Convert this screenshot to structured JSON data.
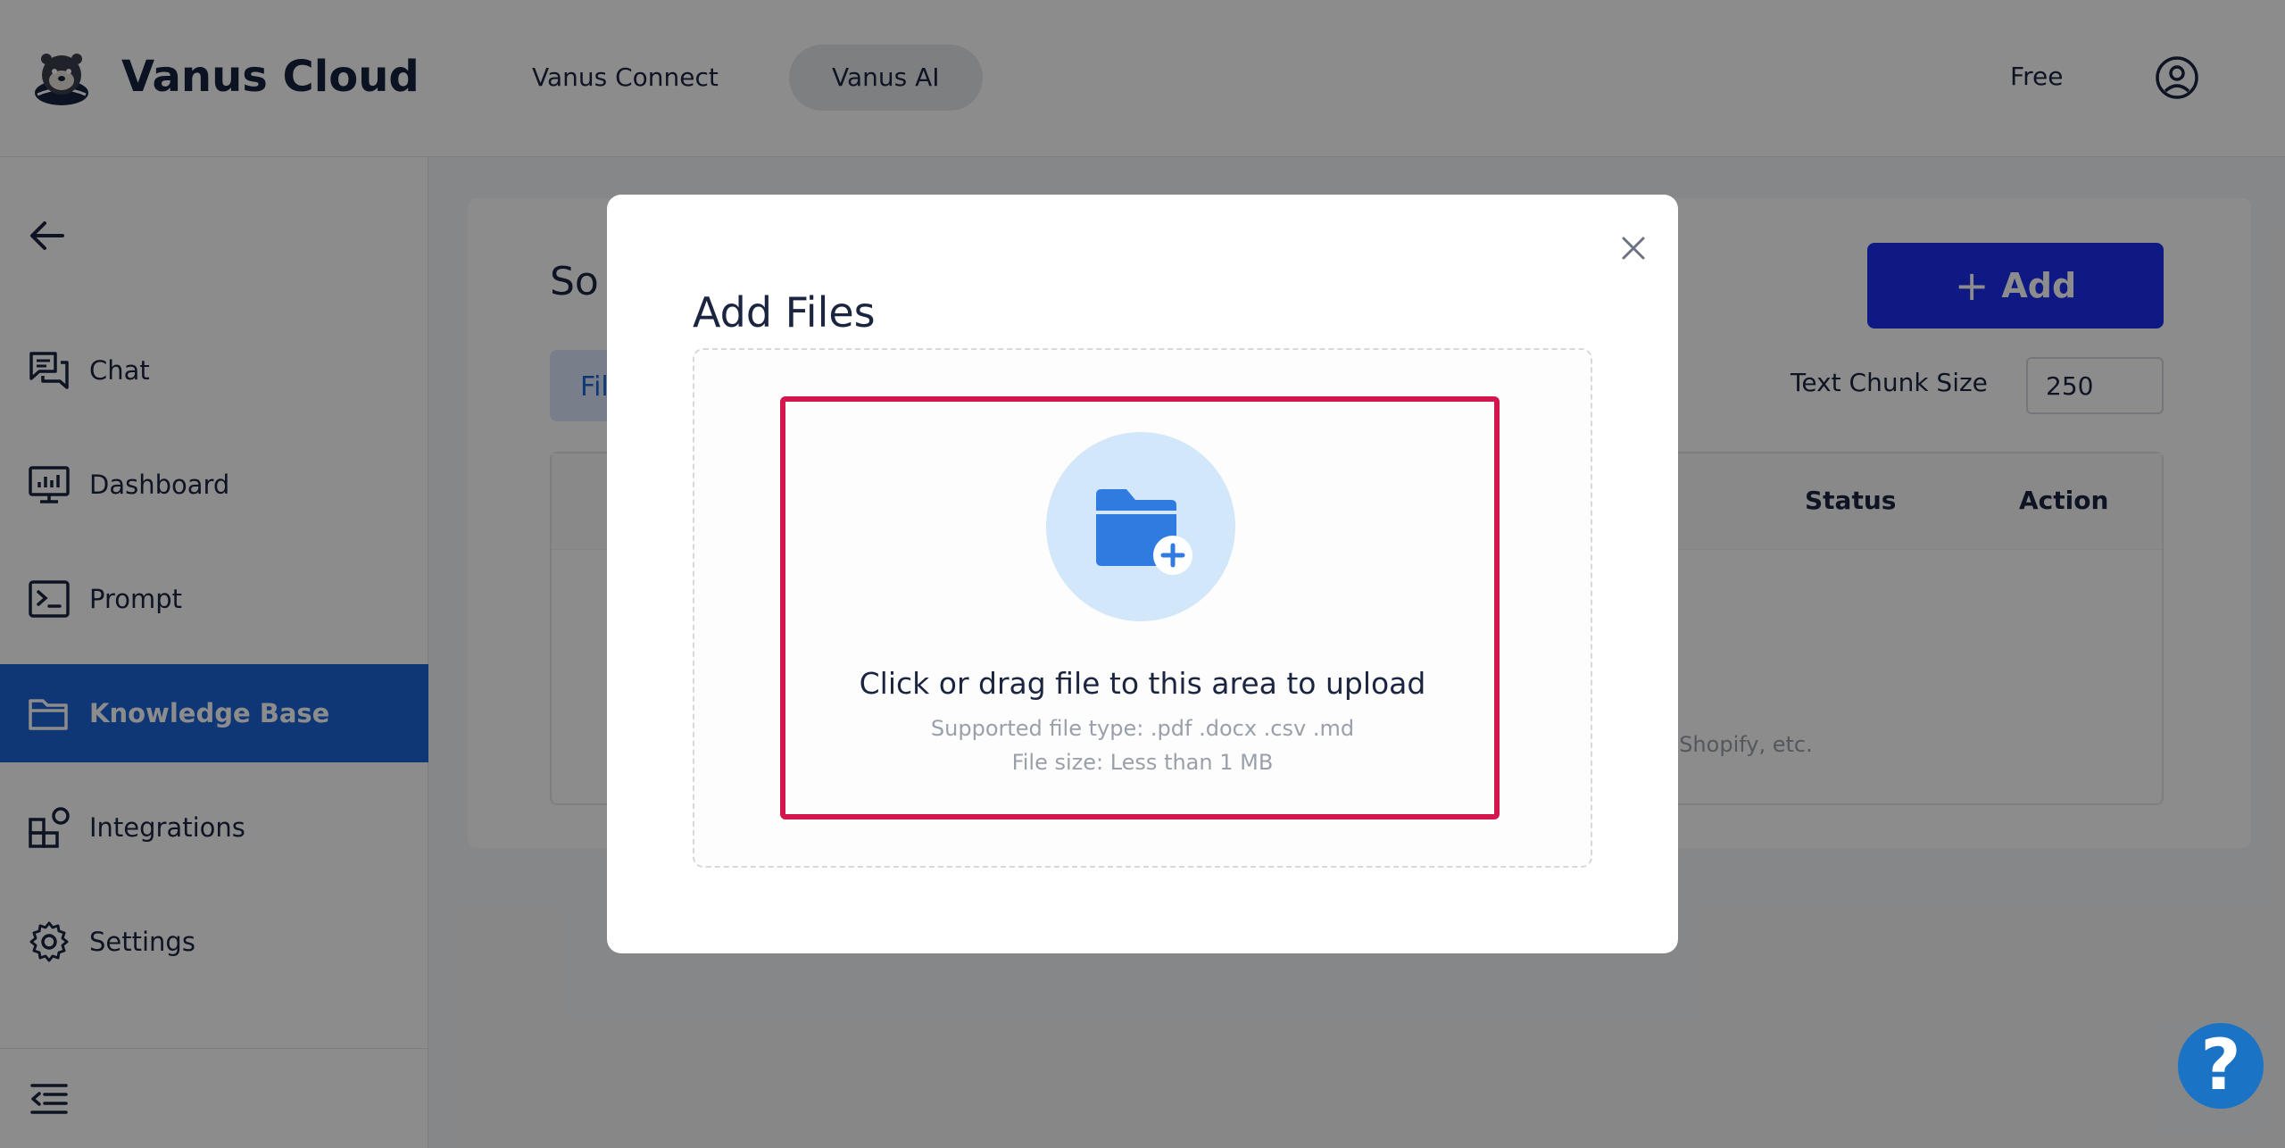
{
  "header": {
    "brand": "Vanus Cloud",
    "tabs": [
      {
        "label": "Vanus Connect"
      },
      {
        "label": "Vanus AI"
      }
    ],
    "plan": "Free"
  },
  "sidebar": {
    "items": [
      {
        "label": "Chat"
      },
      {
        "label": "Dashboard"
      },
      {
        "label": "Prompt"
      },
      {
        "label": "Knowledge Base"
      },
      {
        "label": "Integrations"
      },
      {
        "label": "Settings"
      }
    ]
  },
  "main": {
    "title_visible": "So",
    "tab_visible": "Fil",
    "add_button": "Add",
    "chunk_label": "Text Chunk Size",
    "chunk_value": "250",
    "columns": [
      "Status",
      "Action"
    ],
    "hint_visible": "ab, Shopify, etc."
  },
  "modal": {
    "title": "Add Files",
    "upload_text": "Click or drag file to this area to upload",
    "supported": "Supported file type: .pdf .docx .csv .md",
    "size": "File size: Less than 1 MB"
  },
  "help": "?",
  "colors": {
    "accent": "#1d64d8",
    "add_button": "#1d2ef0",
    "highlight": "#d4164e",
    "help": "#1a73c4"
  }
}
